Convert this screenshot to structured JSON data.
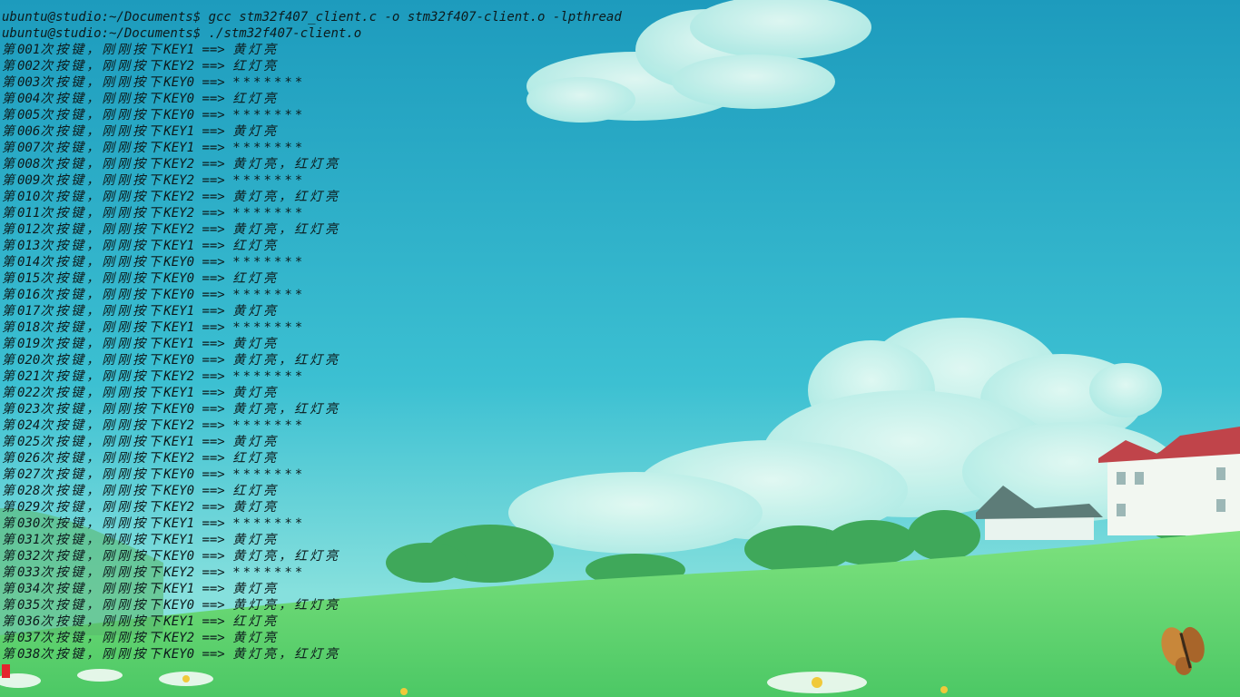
{
  "terminal": {
    "prompt": "ubuntu@studio:~/Documents$",
    "commands": [
      "gcc stm32f407_client.c -o stm32f407-client.o -lpthread",
      "./stm32f407-client.o"
    ],
    "output_prefix": "第",
    "output_count_suffix": "次按键，刚刚按下",
    "output_arrow": "==>",
    "output": [
      {
        "n": "001",
        "key": "KEY1",
        "result": "黄灯亮"
      },
      {
        "n": "002",
        "key": "KEY2",
        "result": "红灯亮"
      },
      {
        "n": "003",
        "key": "KEY0",
        "result": "*******"
      },
      {
        "n": "004",
        "key": "KEY0",
        "result": "红灯亮"
      },
      {
        "n": "005",
        "key": "KEY0",
        "result": "*******"
      },
      {
        "n": "006",
        "key": "KEY1",
        "result": "黄灯亮"
      },
      {
        "n": "007",
        "key": "KEY1",
        "result": "*******"
      },
      {
        "n": "008",
        "key": "KEY2",
        "result": "黄灯亮，红灯亮"
      },
      {
        "n": "009",
        "key": "KEY2",
        "result": "*******"
      },
      {
        "n": "010",
        "key": "KEY2",
        "result": "黄灯亮，红灯亮"
      },
      {
        "n": "011",
        "key": "KEY2",
        "result": "*******"
      },
      {
        "n": "012",
        "key": "KEY2",
        "result": "黄灯亮，红灯亮"
      },
      {
        "n": "013",
        "key": "KEY1",
        "result": "红灯亮"
      },
      {
        "n": "014",
        "key": "KEY0",
        "result": "*******"
      },
      {
        "n": "015",
        "key": "KEY0",
        "result": "红灯亮"
      },
      {
        "n": "016",
        "key": "KEY0",
        "result": "*******"
      },
      {
        "n": "017",
        "key": "KEY1",
        "result": "黄灯亮"
      },
      {
        "n": "018",
        "key": "KEY1",
        "result": "*******"
      },
      {
        "n": "019",
        "key": "KEY1",
        "result": "黄灯亮"
      },
      {
        "n": "020",
        "key": "KEY0",
        "result": "黄灯亮，红灯亮"
      },
      {
        "n": "021",
        "key": "KEY2",
        "result": "*******"
      },
      {
        "n": "022",
        "key": "KEY1",
        "result": "黄灯亮"
      },
      {
        "n": "023",
        "key": "KEY0",
        "result": "黄灯亮，红灯亮"
      },
      {
        "n": "024",
        "key": "KEY2",
        "result": "*******"
      },
      {
        "n": "025",
        "key": "KEY1",
        "result": "黄灯亮"
      },
      {
        "n": "026",
        "key": "KEY2",
        "result": "红灯亮"
      },
      {
        "n": "027",
        "key": "KEY0",
        "result": "*******"
      },
      {
        "n": "028",
        "key": "KEY0",
        "result": "红灯亮"
      },
      {
        "n": "029",
        "key": "KEY2",
        "result": "黄灯亮"
      },
      {
        "n": "030",
        "key": "KEY1",
        "result": "*******"
      },
      {
        "n": "031",
        "key": "KEY1",
        "result": "黄灯亮"
      },
      {
        "n": "032",
        "key": "KEY0",
        "result": "黄灯亮，红灯亮"
      },
      {
        "n": "033",
        "key": "KEY2",
        "result": "*******"
      },
      {
        "n": "034",
        "key": "KEY1",
        "result": "黄灯亮"
      },
      {
        "n": "035",
        "key": "KEY0",
        "result": "黄灯亮，红灯亮"
      },
      {
        "n": "036",
        "key": "KEY1",
        "result": "红灯亮"
      },
      {
        "n": "037",
        "key": "KEY2",
        "result": "黄灯亮"
      },
      {
        "n": "038",
        "key": "KEY0",
        "result": "黄灯亮，红灯亮"
      }
    ]
  },
  "colors": {
    "sky_top": "#1f9fc0",
    "sky_bottom": "#7fdde0",
    "grass": "#5fd87a",
    "terminal_text": "#0c1a1c",
    "cursor": "#e4242e"
  },
  "icons": {
    "cursor": "block-cursor-icon"
  }
}
